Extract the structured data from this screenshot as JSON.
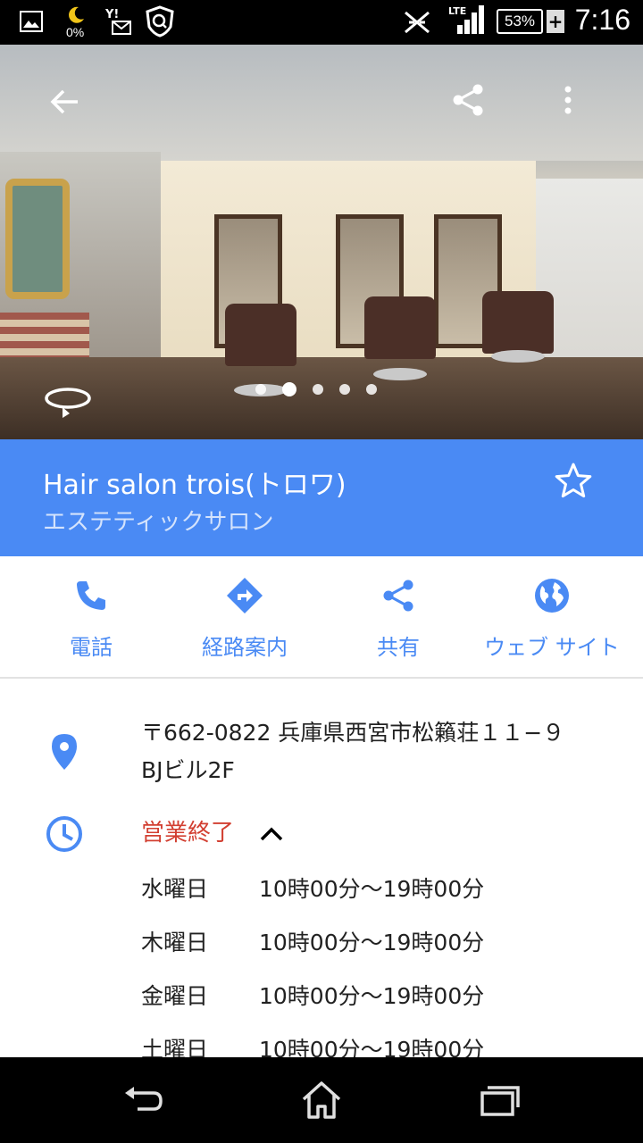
{
  "status_bar": {
    "battery_percent": "53%",
    "battery_plus": "+",
    "moon_percent": "0%",
    "network": "LTE",
    "time": "7:16",
    "icons": [
      "gallery-icon",
      "moon-icon",
      "yahoo-mail-icon",
      "shield-icon",
      "no-signal-icon",
      "signal-icon",
      "battery-icon"
    ]
  },
  "hero": {
    "back_icon": "arrow-back-icon",
    "share_icon": "share-icon",
    "more_icon": "more-vert-icon",
    "rotate_icon": "360-rotate-icon",
    "photo_count": 5,
    "active_photo": 2
  },
  "place": {
    "name": "Hair salon trois(トロワ)",
    "category": "エステティックサロン",
    "accent_color": "#4a8af4"
  },
  "actions": [
    {
      "label": "電話",
      "icon": "phone-icon"
    },
    {
      "label": "経路案内",
      "icon": "directions-icon"
    },
    {
      "label": "共有",
      "icon": "share-icon"
    },
    {
      "label": "ウェブ サイト",
      "icon": "globe-icon"
    }
  ],
  "address": {
    "line1": "〒662-0822 兵庫県西宮市松籟荘１１−９",
    "line2": "BJビル2F"
  },
  "hours": {
    "status": "営業終了",
    "status_color": "#d23f31",
    "rows": [
      {
        "day": "水曜日",
        "time": "10時00分〜19時00分"
      },
      {
        "day": "木曜日",
        "time": "10時00分〜19時00分"
      },
      {
        "day": "金曜日",
        "time": "10時00分〜19時00分"
      },
      {
        "day": "土曜日",
        "time": "10時00分〜19時00分"
      }
    ]
  },
  "nav_bar": {
    "icons": [
      "back-icon",
      "home-icon",
      "recents-icon"
    ]
  }
}
